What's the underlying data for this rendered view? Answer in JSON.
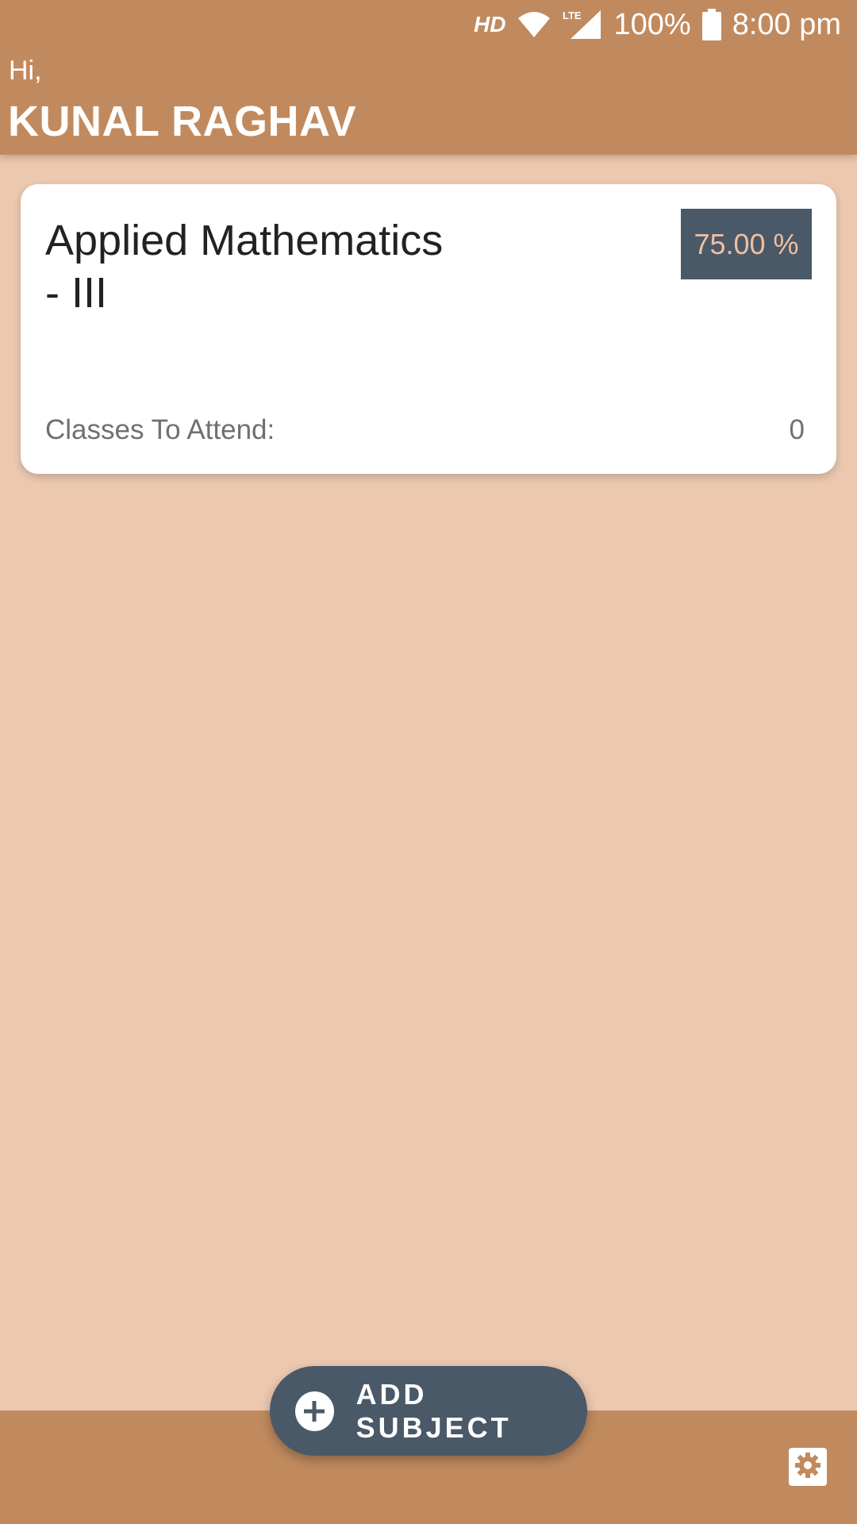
{
  "status_bar": {
    "network_label": "HD",
    "lte_label": "LTE",
    "battery": "100%",
    "time": "8:00 pm"
  },
  "header": {
    "greeting": "Hi,",
    "user_name": "KUNAL RAGHAV"
  },
  "subjects": [
    {
      "name": "Applied Mathematics - III",
      "attendance_percent": "75.00 %",
      "classes_label": "Classes To Attend:",
      "classes_value": "0"
    }
  ],
  "fab": {
    "label": "ADD SUBJECT",
    "icon": "add-circle-icon"
  },
  "settings": {
    "icon": "gear-icon"
  },
  "colors": {
    "primary": "#C18A5E",
    "background": "#EBC8AF",
    "accent_dark": "#4A5968",
    "badge_text": "#F0BFA0"
  }
}
